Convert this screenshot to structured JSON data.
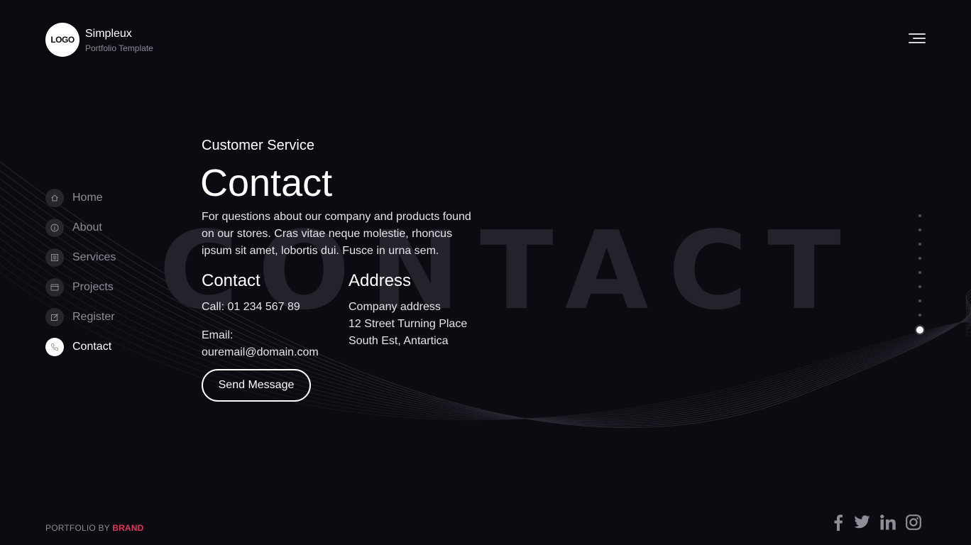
{
  "header": {
    "logo_text": "LOGO",
    "brand_name": "Simpleux",
    "brand_subtitle": "Portfolio Template",
    "menu_icon": "hamburger-menu-icon"
  },
  "nav": {
    "items": [
      {
        "label": "Home",
        "icon": "home-icon",
        "active": false
      },
      {
        "label": "About",
        "icon": "info-icon",
        "active": false
      },
      {
        "label": "Services",
        "icon": "list-icon",
        "active": false
      },
      {
        "label": "Projects",
        "icon": "window-icon",
        "active": false
      },
      {
        "label": "Register",
        "icon": "edit-icon",
        "active": false
      },
      {
        "label": "Contact",
        "icon": "phone-icon",
        "active": true
      }
    ]
  },
  "main": {
    "background_word": "CONTACT",
    "eyebrow": "Customer Service",
    "title": "Contact",
    "intro": "For questions about our company and products found on our stores. Cras vitae neque molestie, rhoncus ipsum sit amet, lobortis dui. Fusce in urna sem.",
    "contact": {
      "heading": "Contact",
      "phone": "Call: 01 234 567 89",
      "email_label": "Email:",
      "email": "ouremail@domain.com"
    },
    "address": {
      "heading": "Address",
      "line1": "Company address",
      "line2": "12 Street Turning Place",
      "line3": "South Est, Antartica"
    },
    "send_button": "Send Message"
  },
  "pager": {
    "dot_count": 9,
    "active_index": 8
  },
  "footer": {
    "prefix": "PORTFOLIO BY",
    "brand": "BRAND",
    "social_icons": [
      "facebook-icon",
      "twitter-icon",
      "linkedin-icon",
      "instagram-icon"
    ]
  },
  "colors": {
    "background": "#0b0b11",
    "accent": "#e0335c",
    "muted_text": "#8d8d96"
  }
}
